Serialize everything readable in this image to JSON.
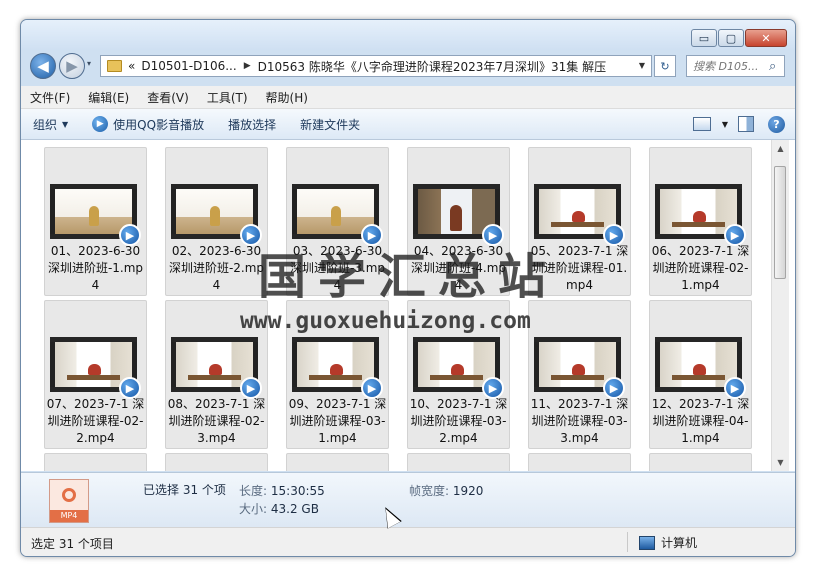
{
  "window": {
    "minimize_label": "▭",
    "maximize_label": "▢",
    "close_label": "✕"
  },
  "navigation": {
    "back_label": "◀",
    "forward_label": "▶",
    "history_label": "▾",
    "address": {
      "overflow": "«",
      "crumb1": "D10501-D106...",
      "crumb2": "D10563 陈晓华《八字命理进阶课程2023年7月深圳》31集 解压"
    },
    "refresh_label": "↻",
    "search_placeholder": "搜索 D105..."
  },
  "menu": [
    "文件(F)",
    "编辑(E)",
    "查看(V)",
    "工具(T)",
    "帮助(H)"
  ],
  "toolbar": {
    "organize": "组织",
    "play_qq": "使用QQ影音播放",
    "play_selection": "播放选择",
    "new_folder": "新建文件夹"
  },
  "files": [
    {
      "name": "01、2023-6-30 深圳进阶班-1.mp4",
      "thumb": "white"
    },
    {
      "name": "02、2023-6-30 深圳进阶班-2.mp4",
      "thumb": "white"
    },
    {
      "name": "03、2023-6-30 深圳进阶班-3.mp4",
      "thumb": "white"
    },
    {
      "name": "04、2023-6-30 深圳进阶班-4.mp4",
      "thumb": "podium"
    },
    {
      "name": "05、2023-7-1 深圳进阶班课程-01.mp4",
      "thumb": "studio"
    },
    {
      "name": "06、2023-7-1 深圳进阶班课程-02-1.mp4",
      "thumb": "studio"
    },
    {
      "name": "07、2023-7-1 深圳进阶班课程-02-2.mp4",
      "thumb": "studio"
    },
    {
      "name": "08、2023-7-1 深圳进阶班课程-02-3.mp4",
      "thumb": "studio"
    },
    {
      "name": "09、2023-7-1 深圳进阶班课程-03-1.mp4",
      "thumb": "studio"
    },
    {
      "name": "10、2023-7-1 深圳进阶班课程-03-2.mp4",
      "thumb": "studio"
    },
    {
      "name": "11、2023-7-1 深圳进阶班课程-03-3.mp4",
      "thumb": "studio"
    },
    {
      "name": "12、2023-7-1 深圳进阶班课程-04-1.mp4",
      "thumb": "studio"
    }
  ],
  "details": {
    "icon_tag": "MP4",
    "selected": "已选择 31 个项",
    "duration_label": "长度:",
    "duration_value": "15:30:55",
    "size_label": "大小:",
    "size_value": "43.2 GB",
    "width_label": "帧宽度:",
    "width_value": "1920"
  },
  "status": {
    "left": "选定 31 个项目",
    "right": "计算机"
  },
  "watermark": {
    "text": "国学汇总站",
    "url": "www.guoxuehuizong.com"
  },
  "scrollbar": {
    "up_label": "▲",
    "down_label": "▼"
  }
}
